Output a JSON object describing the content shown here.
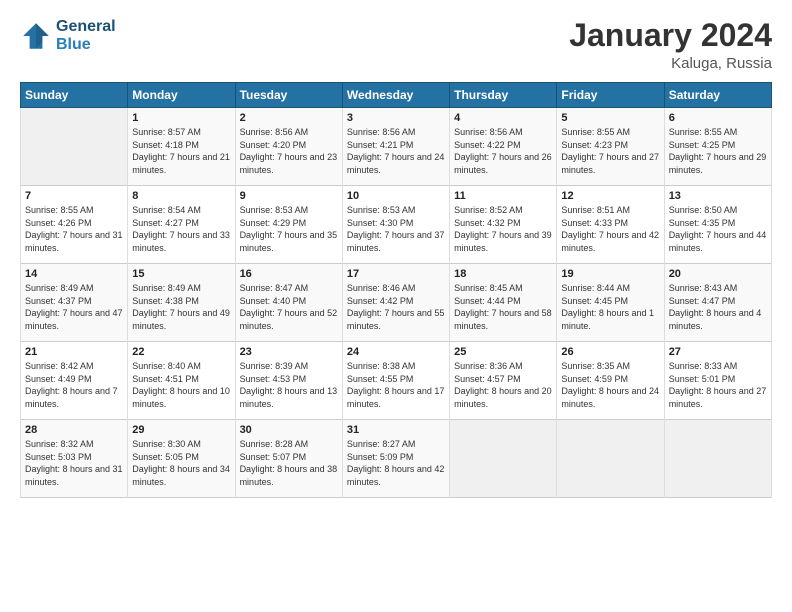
{
  "header": {
    "logo_line1": "General",
    "logo_line2": "Blue",
    "month": "January 2024",
    "location": "Kaluga, Russia"
  },
  "weekdays": [
    "Sunday",
    "Monday",
    "Tuesday",
    "Wednesday",
    "Thursday",
    "Friday",
    "Saturday"
  ],
  "weeks": [
    [
      {
        "day": "",
        "sunrise": "",
        "sunset": "",
        "daylight": ""
      },
      {
        "day": "1",
        "sunrise": "Sunrise: 8:57 AM",
        "sunset": "Sunset: 4:18 PM",
        "daylight": "Daylight: 7 hours and 21 minutes."
      },
      {
        "day": "2",
        "sunrise": "Sunrise: 8:56 AM",
        "sunset": "Sunset: 4:20 PM",
        "daylight": "Daylight: 7 hours and 23 minutes."
      },
      {
        "day": "3",
        "sunrise": "Sunrise: 8:56 AM",
        "sunset": "Sunset: 4:21 PM",
        "daylight": "Daylight: 7 hours and 24 minutes."
      },
      {
        "day": "4",
        "sunrise": "Sunrise: 8:56 AM",
        "sunset": "Sunset: 4:22 PM",
        "daylight": "Daylight: 7 hours and 26 minutes."
      },
      {
        "day": "5",
        "sunrise": "Sunrise: 8:55 AM",
        "sunset": "Sunset: 4:23 PM",
        "daylight": "Daylight: 7 hours and 27 minutes."
      },
      {
        "day": "6",
        "sunrise": "Sunrise: 8:55 AM",
        "sunset": "Sunset: 4:25 PM",
        "daylight": "Daylight: 7 hours and 29 minutes."
      }
    ],
    [
      {
        "day": "7",
        "sunrise": "Sunrise: 8:55 AM",
        "sunset": "Sunset: 4:26 PM",
        "daylight": "Daylight: 7 hours and 31 minutes."
      },
      {
        "day": "8",
        "sunrise": "Sunrise: 8:54 AM",
        "sunset": "Sunset: 4:27 PM",
        "daylight": "Daylight: 7 hours and 33 minutes."
      },
      {
        "day": "9",
        "sunrise": "Sunrise: 8:53 AM",
        "sunset": "Sunset: 4:29 PM",
        "daylight": "Daylight: 7 hours and 35 minutes."
      },
      {
        "day": "10",
        "sunrise": "Sunrise: 8:53 AM",
        "sunset": "Sunset: 4:30 PM",
        "daylight": "Daylight: 7 hours and 37 minutes."
      },
      {
        "day": "11",
        "sunrise": "Sunrise: 8:52 AM",
        "sunset": "Sunset: 4:32 PM",
        "daylight": "Daylight: 7 hours and 39 minutes."
      },
      {
        "day": "12",
        "sunrise": "Sunrise: 8:51 AM",
        "sunset": "Sunset: 4:33 PM",
        "daylight": "Daylight: 7 hours and 42 minutes."
      },
      {
        "day": "13",
        "sunrise": "Sunrise: 8:50 AM",
        "sunset": "Sunset: 4:35 PM",
        "daylight": "Daylight: 7 hours and 44 minutes."
      }
    ],
    [
      {
        "day": "14",
        "sunrise": "Sunrise: 8:49 AM",
        "sunset": "Sunset: 4:37 PM",
        "daylight": "Daylight: 7 hours and 47 minutes."
      },
      {
        "day": "15",
        "sunrise": "Sunrise: 8:49 AM",
        "sunset": "Sunset: 4:38 PM",
        "daylight": "Daylight: 7 hours and 49 minutes."
      },
      {
        "day": "16",
        "sunrise": "Sunrise: 8:47 AM",
        "sunset": "Sunset: 4:40 PM",
        "daylight": "Daylight: 7 hours and 52 minutes."
      },
      {
        "day": "17",
        "sunrise": "Sunrise: 8:46 AM",
        "sunset": "Sunset: 4:42 PM",
        "daylight": "Daylight: 7 hours and 55 minutes."
      },
      {
        "day": "18",
        "sunrise": "Sunrise: 8:45 AM",
        "sunset": "Sunset: 4:44 PM",
        "daylight": "Daylight: 7 hours and 58 minutes."
      },
      {
        "day": "19",
        "sunrise": "Sunrise: 8:44 AM",
        "sunset": "Sunset: 4:45 PM",
        "daylight": "Daylight: 8 hours and 1 minute."
      },
      {
        "day": "20",
        "sunrise": "Sunrise: 8:43 AM",
        "sunset": "Sunset: 4:47 PM",
        "daylight": "Daylight: 8 hours and 4 minutes."
      }
    ],
    [
      {
        "day": "21",
        "sunrise": "Sunrise: 8:42 AM",
        "sunset": "Sunset: 4:49 PM",
        "daylight": "Daylight: 8 hours and 7 minutes."
      },
      {
        "day": "22",
        "sunrise": "Sunrise: 8:40 AM",
        "sunset": "Sunset: 4:51 PM",
        "daylight": "Daylight: 8 hours and 10 minutes."
      },
      {
        "day": "23",
        "sunrise": "Sunrise: 8:39 AM",
        "sunset": "Sunset: 4:53 PM",
        "daylight": "Daylight: 8 hours and 13 minutes."
      },
      {
        "day": "24",
        "sunrise": "Sunrise: 8:38 AM",
        "sunset": "Sunset: 4:55 PM",
        "daylight": "Daylight: 8 hours and 17 minutes."
      },
      {
        "day": "25",
        "sunrise": "Sunrise: 8:36 AM",
        "sunset": "Sunset: 4:57 PM",
        "daylight": "Daylight: 8 hours and 20 minutes."
      },
      {
        "day": "26",
        "sunrise": "Sunrise: 8:35 AM",
        "sunset": "Sunset: 4:59 PM",
        "daylight": "Daylight: 8 hours and 24 minutes."
      },
      {
        "day": "27",
        "sunrise": "Sunrise: 8:33 AM",
        "sunset": "Sunset: 5:01 PM",
        "daylight": "Daylight: 8 hours and 27 minutes."
      }
    ],
    [
      {
        "day": "28",
        "sunrise": "Sunrise: 8:32 AM",
        "sunset": "Sunset: 5:03 PM",
        "daylight": "Daylight: 8 hours and 31 minutes."
      },
      {
        "day": "29",
        "sunrise": "Sunrise: 8:30 AM",
        "sunset": "Sunset: 5:05 PM",
        "daylight": "Daylight: 8 hours and 34 minutes."
      },
      {
        "day": "30",
        "sunrise": "Sunrise: 8:28 AM",
        "sunset": "Sunset: 5:07 PM",
        "daylight": "Daylight: 8 hours and 38 minutes."
      },
      {
        "day": "31",
        "sunrise": "Sunrise: 8:27 AM",
        "sunset": "Sunset: 5:09 PM",
        "daylight": "Daylight: 8 hours and 42 minutes."
      },
      {
        "day": "",
        "sunrise": "",
        "sunset": "",
        "daylight": ""
      },
      {
        "day": "",
        "sunrise": "",
        "sunset": "",
        "daylight": ""
      },
      {
        "day": "",
        "sunrise": "",
        "sunset": "",
        "daylight": ""
      }
    ]
  ]
}
